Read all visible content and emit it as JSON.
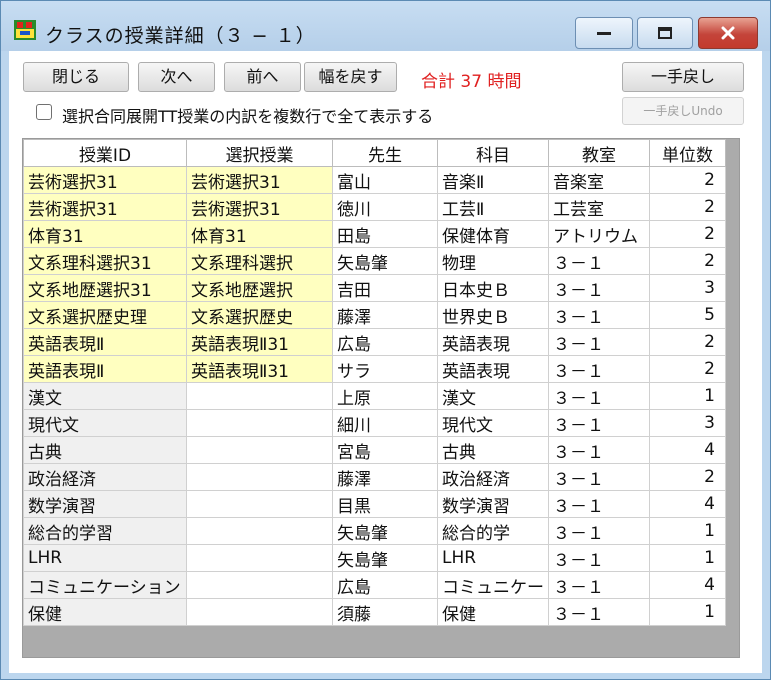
{
  "window": {
    "title": "クラスの授業詳細（３ − １）",
    "controls": [
      "minimize-icon",
      "maximize-icon",
      "close-icon"
    ],
    "close_color": "#c43b2e"
  },
  "toolbar": {
    "close_label": "閉じる",
    "next_label": "次へ",
    "prev_label": "前へ",
    "reset_width_label": "幅を戻す",
    "total_text": "合計 37 時間",
    "total_color": "#e02020",
    "undo_label": "一手戻し",
    "undo_undo_label": "一手戻しUndo"
  },
  "options": {
    "show_tt_label": "選択合同展開TT授業の内訳を複数行で全て表示する",
    "show_tt_checked": false
  },
  "table": {
    "highlight_color": "#ffffc0",
    "columns": [
      "授業ID",
      "選択授業",
      "先生",
      "科目",
      "教室",
      "単位数"
    ],
    "rows": [
      {
        "id": "芸術選択31",
        "sel": "芸術選択31",
        "teacher": "富山",
        "subject": "音楽Ⅱ",
        "room": "音楽室",
        "units": "2",
        "highlight": true
      },
      {
        "id": "芸術選択31",
        "sel": "芸術選択31",
        "teacher": "徳川",
        "subject": "工芸Ⅱ",
        "room": "工芸室",
        "units": "2",
        "highlight": true
      },
      {
        "id": "体育31",
        "sel": "体育31",
        "teacher": "田島",
        "subject": "保健体育",
        "room": "アトリウム",
        "units": "2",
        "highlight": true
      },
      {
        "id": "文系理科選択31",
        "sel": "文系理科選択",
        "teacher": "矢島肇",
        "subject": "物理",
        "room": "３－１",
        "units": "2",
        "highlight": true
      },
      {
        "id": "文系地歴選択31",
        "sel": "文系地歴選択",
        "teacher": "吉田",
        "subject": "日本史Ｂ",
        "room": "３－１",
        "units": "3",
        "highlight": true
      },
      {
        "id": "文系選択歴史理",
        "sel": "文系選択歴史",
        "teacher": "藤澤",
        "subject": "世界史Ｂ",
        "room": "３－１",
        "units": "5",
        "highlight": true
      },
      {
        "id": "英語表現Ⅱ",
        "sel": "英語表現Ⅱ31",
        "teacher": "広島",
        "subject": "英語表現",
        "room": "３－１",
        "units": "2",
        "highlight": true
      },
      {
        "id": "英語表現Ⅱ",
        "sel": "英語表現Ⅱ31",
        "teacher": "サラ",
        "subject": "英語表現",
        "room": "３－１",
        "units": "2",
        "highlight": true
      },
      {
        "id": "漢文",
        "sel": "",
        "teacher": "上原",
        "subject": "漢文",
        "room": "３－１",
        "units": "1",
        "highlight": false
      },
      {
        "id": "現代文",
        "sel": "",
        "teacher": "細川",
        "subject": "現代文",
        "room": "３－１",
        "units": "3",
        "highlight": false
      },
      {
        "id": "古典",
        "sel": "",
        "teacher": "宮島",
        "subject": "古典",
        "room": "３－１",
        "units": "4",
        "highlight": false
      },
      {
        "id": "政治経済",
        "sel": "",
        "teacher": "藤澤",
        "subject": "政治経済",
        "room": "３－１",
        "units": "2",
        "highlight": false
      },
      {
        "id": "数学演習",
        "sel": "",
        "teacher": "目黒",
        "subject": "数学演習",
        "room": "３－１",
        "units": "4",
        "highlight": false
      },
      {
        "id": "総合的学習",
        "sel": "",
        "teacher": "矢島肇",
        "subject": "総合的学",
        "room": "３－１",
        "units": "1",
        "highlight": false
      },
      {
        "id": "LHR",
        "sel": "",
        "teacher": "矢島肇",
        "subject": "LHR",
        "room": "３－１",
        "units": "1",
        "highlight": false
      },
      {
        "id": "コミュニケーション",
        "sel": "",
        "teacher": "広島",
        "subject": "コミュニケー",
        "room": "３－１",
        "units": "4",
        "highlight": false
      },
      {
        "id": "保健",
        "sel": "",
        "teacher": "須藤",
        "subject": "保健",
        "room": "３－１",
        "units": "1",
        "highlight": false
      }
    ]
  }
}
